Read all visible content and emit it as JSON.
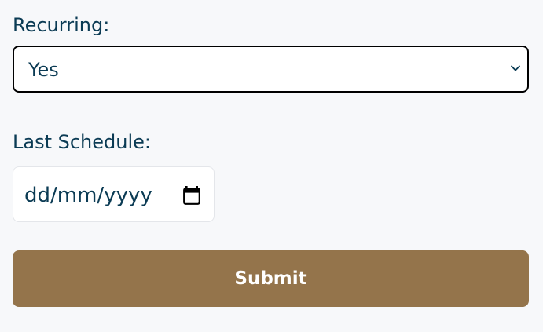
{
  "form": {
    "recurring": {
      "label": "Recurring:",
      "selected_value": "Yes",
      "icon": "chevron-down-icon"
    },
    "last_schedule": {
      "label": "Last Schedule:",
      "placeholder": "dd/mm/yyyy",
      "icon": "calendar-icon"
    },
    "submit_label": "Submit"
  },
  "colors": {
    "background": "#f7f8fa",
    "text": "#0b3b54",
    "submit_bg": "#94744b",
    "submit_text": "#ffffff"
  }
}
